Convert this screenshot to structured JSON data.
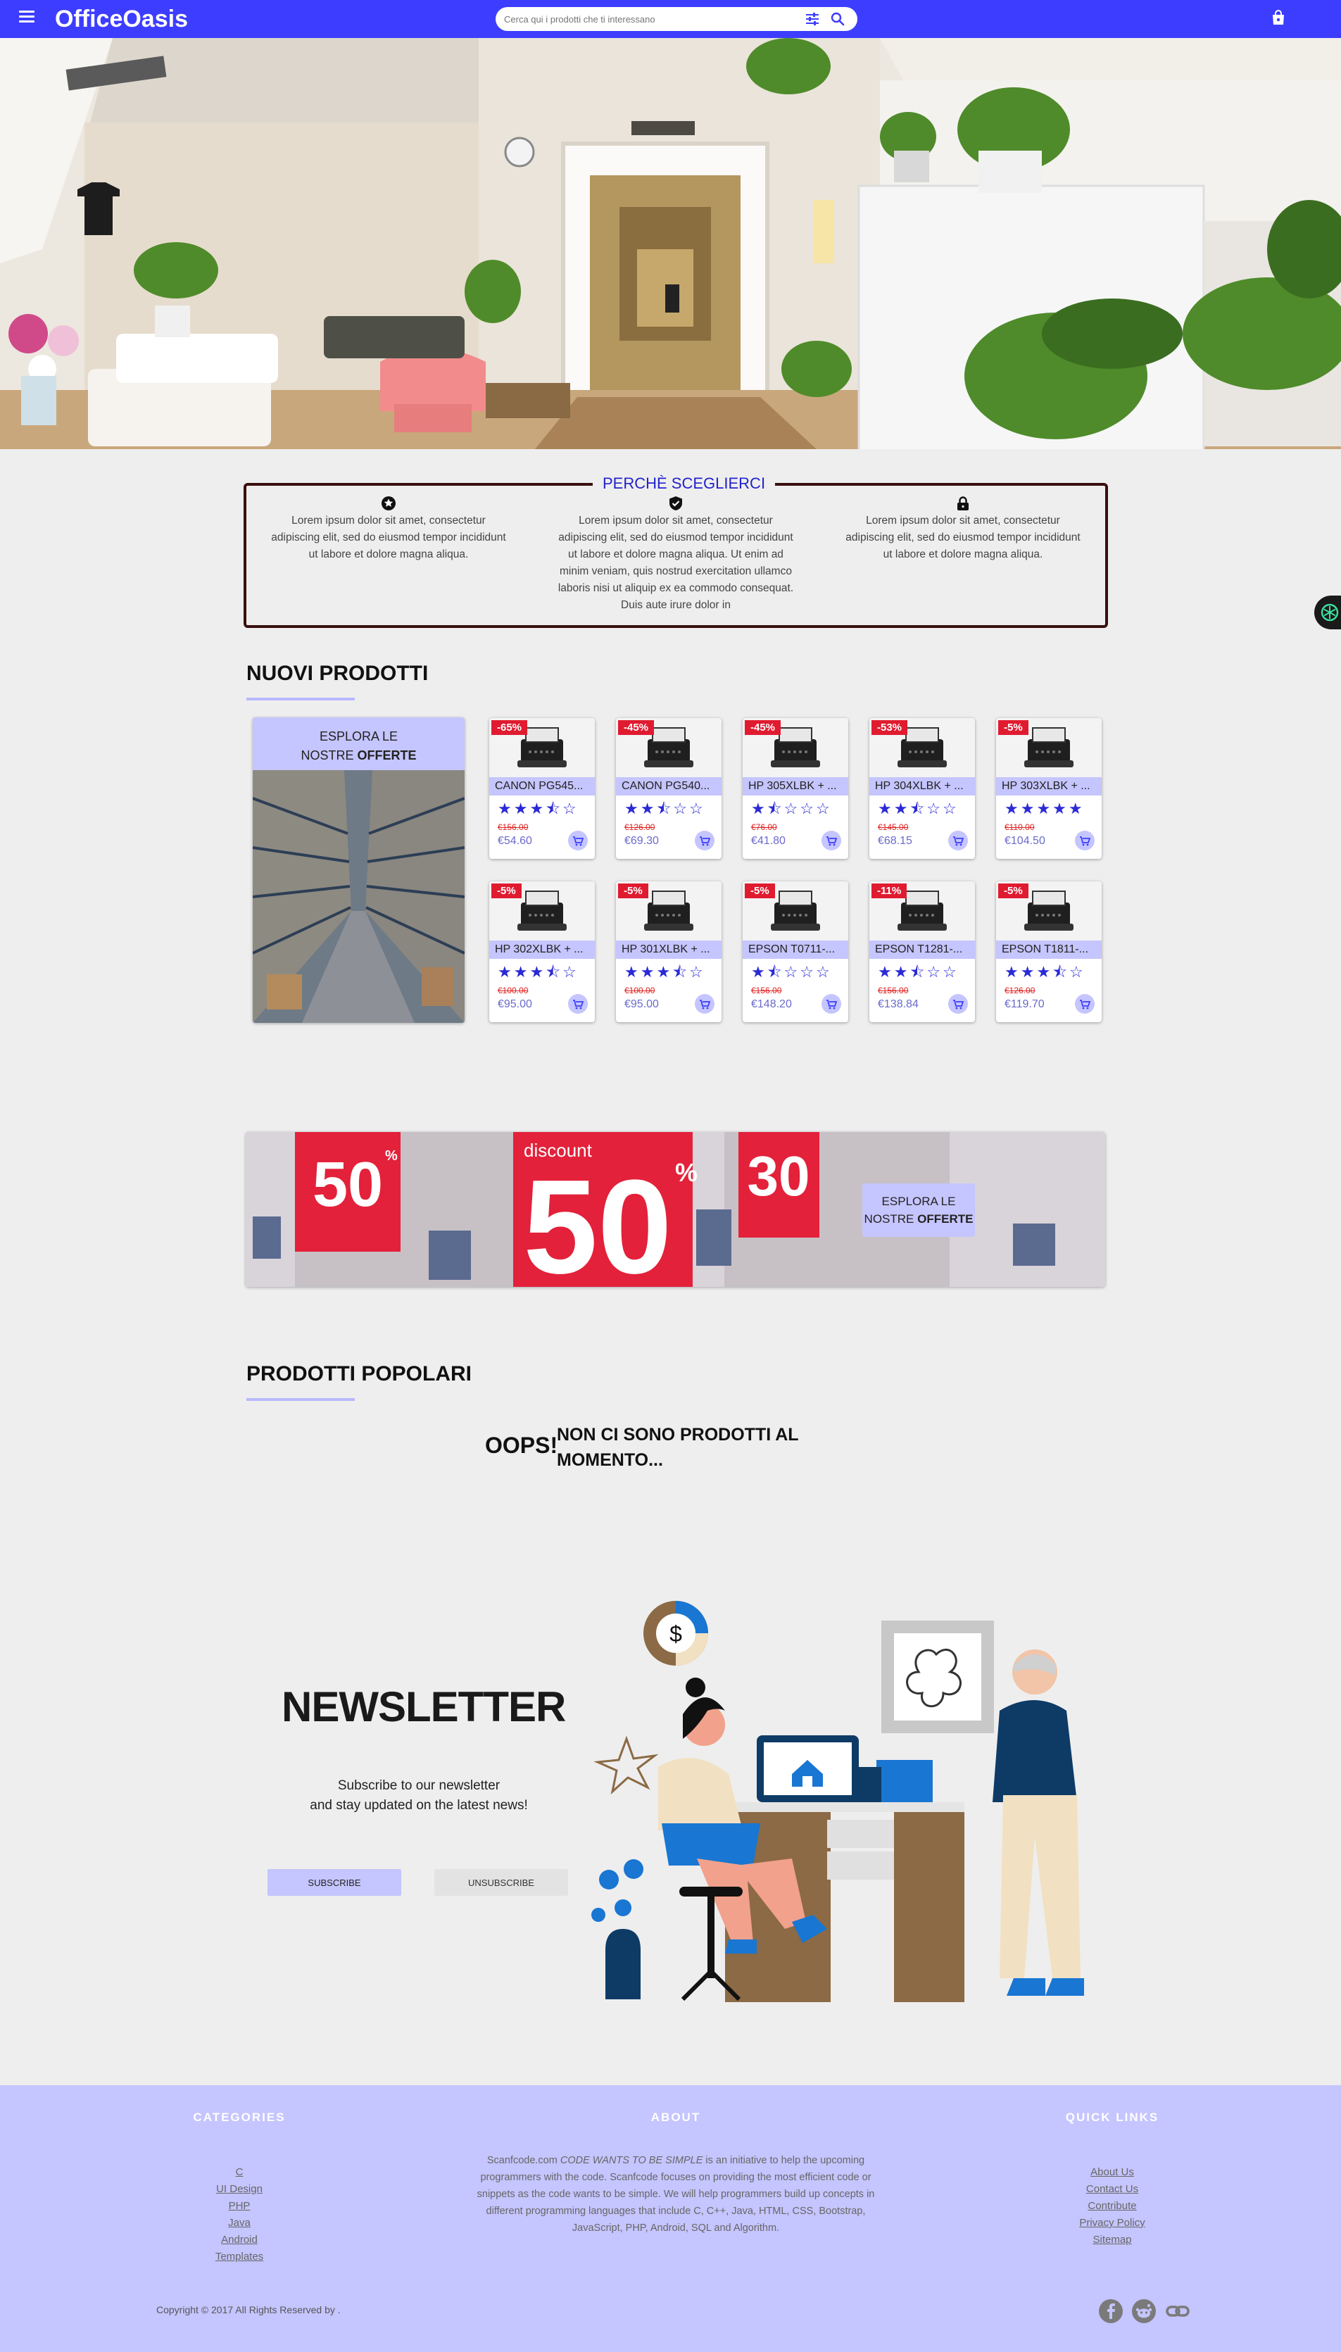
{
  "header": {
    "brand": "OfficeOasis",
    "search_placeholder": "Cerca qui i prodotti che ti interessano"
  },
  "why": {
    "title": "PERCHÈ SCEGLIERCI",
    "columns": [
      {
        "icon": "star-circle-icon",
        "text": "Lorem ipsum dolor sit amet, consectetur adipiscing elit, sed do eiusmod tempor incididunt ut labore et dolore magna aliqua."
      },
      {
        "icon": "shield-check-icon",
        "text": "Lorem ipsum dolor sit amet, consectetur adipiscing elit, sed do eiusmod tempor incididunt ut labore et dolore magna aliqua. Ut enim ad minim veniam, quis nostrud exercitation ullamco laboris nisi ut aliquip ex ea commodo consequat. Duis aute irure dolor in"
      },
      {
        "icon": "lock-icon",
        "text": "Lorem ipsum dolor sit amet, consectetur adipiscing elit, sed do eiusmod tempor incididunt ut labore et dolore magna aliqua."
      }
    ]
  },
  "new_products": {
    "title": "NUOVI PRODOTTI",
    "explore": {
      "line1": "ESPLORA LE",
      "line2_prefix": "NOSTRE ",
      "line2_bold": "OFFERTE"
    },
    "items": [
      {
        "badge": "-65%",
        "name": "CANON PG545...",
        "stars": "★★★⯪☆",
        "old": "€156.00",
        "price": "€54.60"
      },
      {
        "badge": "-45%",
        "name": "CANON PG540...",
        "stars": "★★⯪☆☆",
        "old": "€126.00",
        "price": "€69.30"
      },
      {
        "badge": "-45%",
        "name": "HP 305XLBK + ...",
        "stars": "★⯪☆☆☆",
        "old": "€76.00",
        "price": "€41.80"
      },
      {
        "badge": "-53%",
        "name": "HP 304XLBK + ...",
        "stars": "★★⯪☆☆",
        "old": "€145.00",
        "price": "€68.15"
      },
      {
        "badge": "-5%",
        "name": "HP 303XLBK + ...",
        "stars": "★★★★★",
        "old": "€110.00",
        "price": "€104.50"
      },
      {
        "badge": "-5%",
        "name": "HP 302XLBK + ...",
        "stars": "★★★⯪☆",
        "old": "€100.00",
        "price": "€95.00"
      },
      {
        "badge": "-5%",
        "name": "HP 301XLBK + ...",
        "stars": "★★★⯪☆",
        "old": "€100.00",
        "price": "€95.00"
      },
      {
        "badge": "-5%",
        "name": "EPSON T0711-...",
        "stars": "★⯪☆☆☆",
        "old": "€156.00",
        "price": "€148.20"
      },
      {
        "badge": "-11%",
        "name": "EPSON T1281-...",
        "stars": "★★⯪☆☆",
        "old": "€156.00",
        "price": "€138.84"
      },
      {
        "badge": "-5%",
        "name": "EPSON T1811-...",
        "stars": "★★★⯪☆",
        "old": "€126.00",
        "price": "€119.70"
      }
    ]
  },
  "banner": {
    "line1": "ESPLORA LE",
    "line2_prefix": "NOSTRE ",
    "line2_bold": "OFFERTE",
    "big_texts": [
      "50",
      "50",
      "30"
    ],
    "discount_word": "discount"
  },
  "popular": {
    "title": "PRODOTTI POPOLARI",
    "oops": "OOPS!",
    "message": "NON CI SONO PRODOTTI AL MOMENTO..."
  },
  "newsletter": {
    "title": "NEWSLETTER",
    "line1": "Subscribe to our newsletter",
    "line2": "and stay updated on the latest news!",
    "subscribe": "SUBSCRIBE",
    "unsubscribe": "UNSUBSCRIBE"
  },
  "footer": {
    "categories_title": "CATEGORIES",
    "categories": [
      "C",
      "UI Design",
      "PHP",
      "Java",
      "Android",
      "Templates"
    ],
    "about_title": "ABOUT",
    "about_prefix": "Scanfcode.com ",
    "about_italic": "CODE WANTS TO BE SIMPLE",
    "about_rest": " is an initiative to help the upcoming programmers with the code. Scanfcode focuses on providing the most efficient code or snippets as the code wants to be simple. We will help programmers build up concepts in different programming languages that include C, C++, Java, HTML, CSS, Bootstrap, JavaScript, PHP, Android, SQL and Algorithm.",
    "links_title": "QUICK LINKS",
    "links": [
      "About Us",
      "Contact Us",
      "Contribute",
      "Privacy Policy",
      "Sitemap"
    ],
    "copyright": "Copyright © 2017 All Rights Reserved by ."
  },
  "colors": {
    "primary": "#3d3dff",
    "accent_light": "#c5c5ff",
    "badge_red": "#e01b30",
    "star_blue": "#2a2ad6"
  }
}
